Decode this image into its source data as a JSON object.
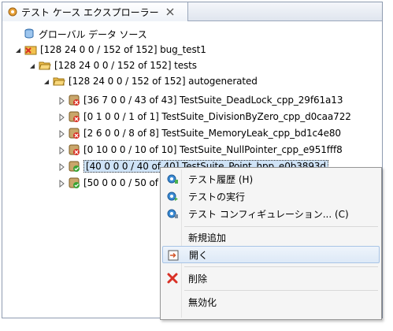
{
  "view": {
    "tab_title": "テスト ケース エクスプローラー",
    "tab_close_icon": "close-icon"
  },
  "tree": {
    "global": "グローバル データ ソース",
    "bug_test1": "[128 24 0 0 / 152 of 152] bug_test1",
    "tests": "[128 24 0 0 / 152 of 152] tests",
    "autogenerated": "[128 24 0 0 / 152 of 152] autogenerated",
    "suites": [
      "[36 7 0 0 / 43 of 43] TestSuite_DeadLock_cpp_29f61a13",
      "[0 1 0 0 / 1 of 1] TestSuite_DivisionByZero_cpp_d0caa722",
      "[2 6 0 0 / 8 of 8] TestSuite_MemoryLeak_cpp_bd1c4e80",
      "[0 10 0 0 / 10 of 10] TestSuite_NullPointer_cpp_e951fff8",
      "[40 0 0 0 / 40 of 40] TestSuite_Point_hpp_e0b3893d",
      "[50 0 0 0 / 50 of"
    ]
  },
  "menu": {
    "history": "テスト履歴 (H)",
    "run": "テストの実行",
    "config": "テスト コンフィギュレーション... (C)",
    "new": "新規追加",
    "open": "開く",
    "delete": "削除",
    "disable": "無効化"
  },
  "colors": {
    "selection": "#cfe3f7",
    "menu_highlight": "#dde9f7",
    "fail_red": "#d93025",
    "pass_green": "#3aa335",
    "folder_yellow": "#f2c14e"
  }
}
